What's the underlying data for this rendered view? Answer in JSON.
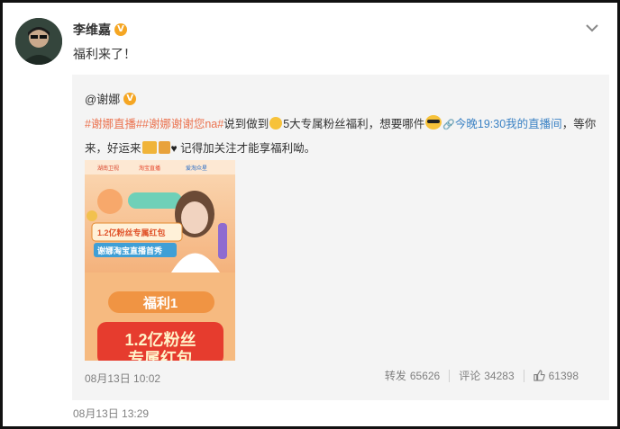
{
  "post": {
    "author": "李维嘉",
    "verified_badge": "V",
    "text": "福利来了！",
    "date": "08月13日 13:29"
  },
  "repost": {
    "author": "@谢娜",
    "verified_badge": "V",
    "hashtag1": "#谢娜直播#",
    "hashtag2": "#谢娜谢谢您na#",
    "text1": "说到做到",
    "text2": "5大专属粉丝福利",
    "text3": "，想要哪件",
    "link_text": "今晚19:30我的直播间",
    "text4": "，等你来，好运来",
    "text5": "记得加关注才能享福利呦。",
    "date": "08月13日 10:02",
    "poster": {
      "brands": [
        "湖南卫视",
        "淘宝直播",
        "爱淘众星"
      ],
      "headline": "1.2亿粉丝专属红包",
      "subline": "谢娜淘宝直播首秀",
      "welfare_label": "福利1",
      "big_text": "1.2亿粉丝",
      "big_text2": "专属红包"
    },
    "stats": {
      "forward_label": "转发",
      "forward_count": "65626",
      "comment_label": "评论",
      "comment_count": "34283",
      "like_count": "61398"
    }
  },
  "colors": {
    "link_orange": "#eb7350",
    "link_blue": "#3b82c4",
    "badge": "#f5a623",
    "repost_bg": "#f4f4f4"
  },
  "icons": [
    "avatar",
    "verified-icon",
    "chevron-down-icon",
    "link-icon",
    "forward-icon",
    "comment-icon",
    "like-icon"
  ]
}
